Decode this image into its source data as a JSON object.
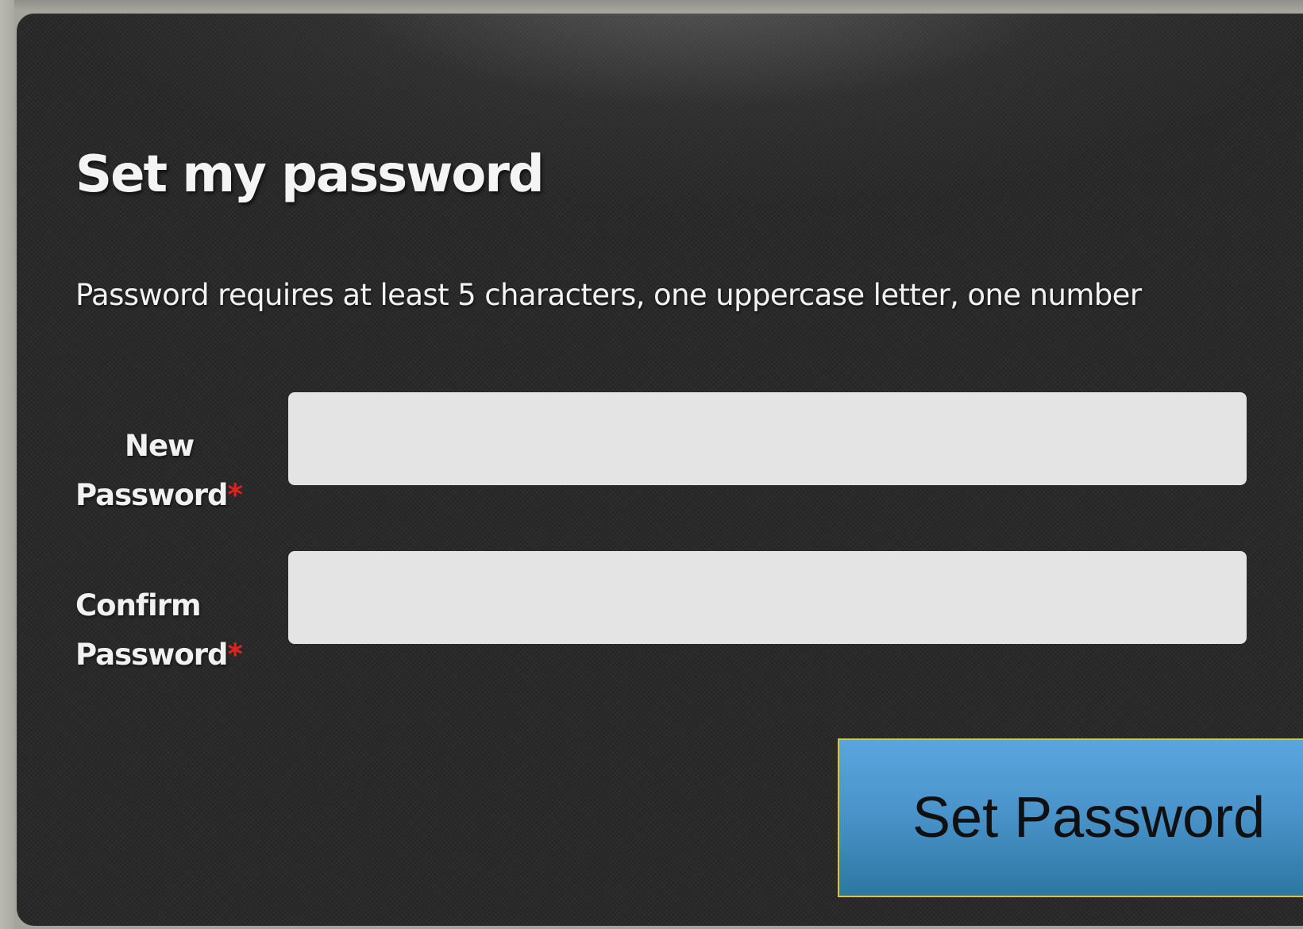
{
  "form": {
    "title": "Set my password",
    "requirements": "Password requires at least 5 characters, one uppercase letter, one number",
    "required_marker": "*",
    "new_password": {
      "label_line1": "New",
      "label_line2": "Password",
      "value": "",
      "placeholder": ""
    },
    "confirm_password": {
      "label_line1": "Confirm",
      "label_line2": "Password",
      "value": "",
      "placeholder": ""
    },
    "submit_label": "Set Password"
  },
  "colors": {
    "panel_background": "#262626",
    "input_background": "#e4e4e4",
    "required_marker": "#e8201c",
    "button_top": "#5aa5de",
    "button_bottom": "#2d77a4",
    "button_border": "#d7c641"
  }
}
